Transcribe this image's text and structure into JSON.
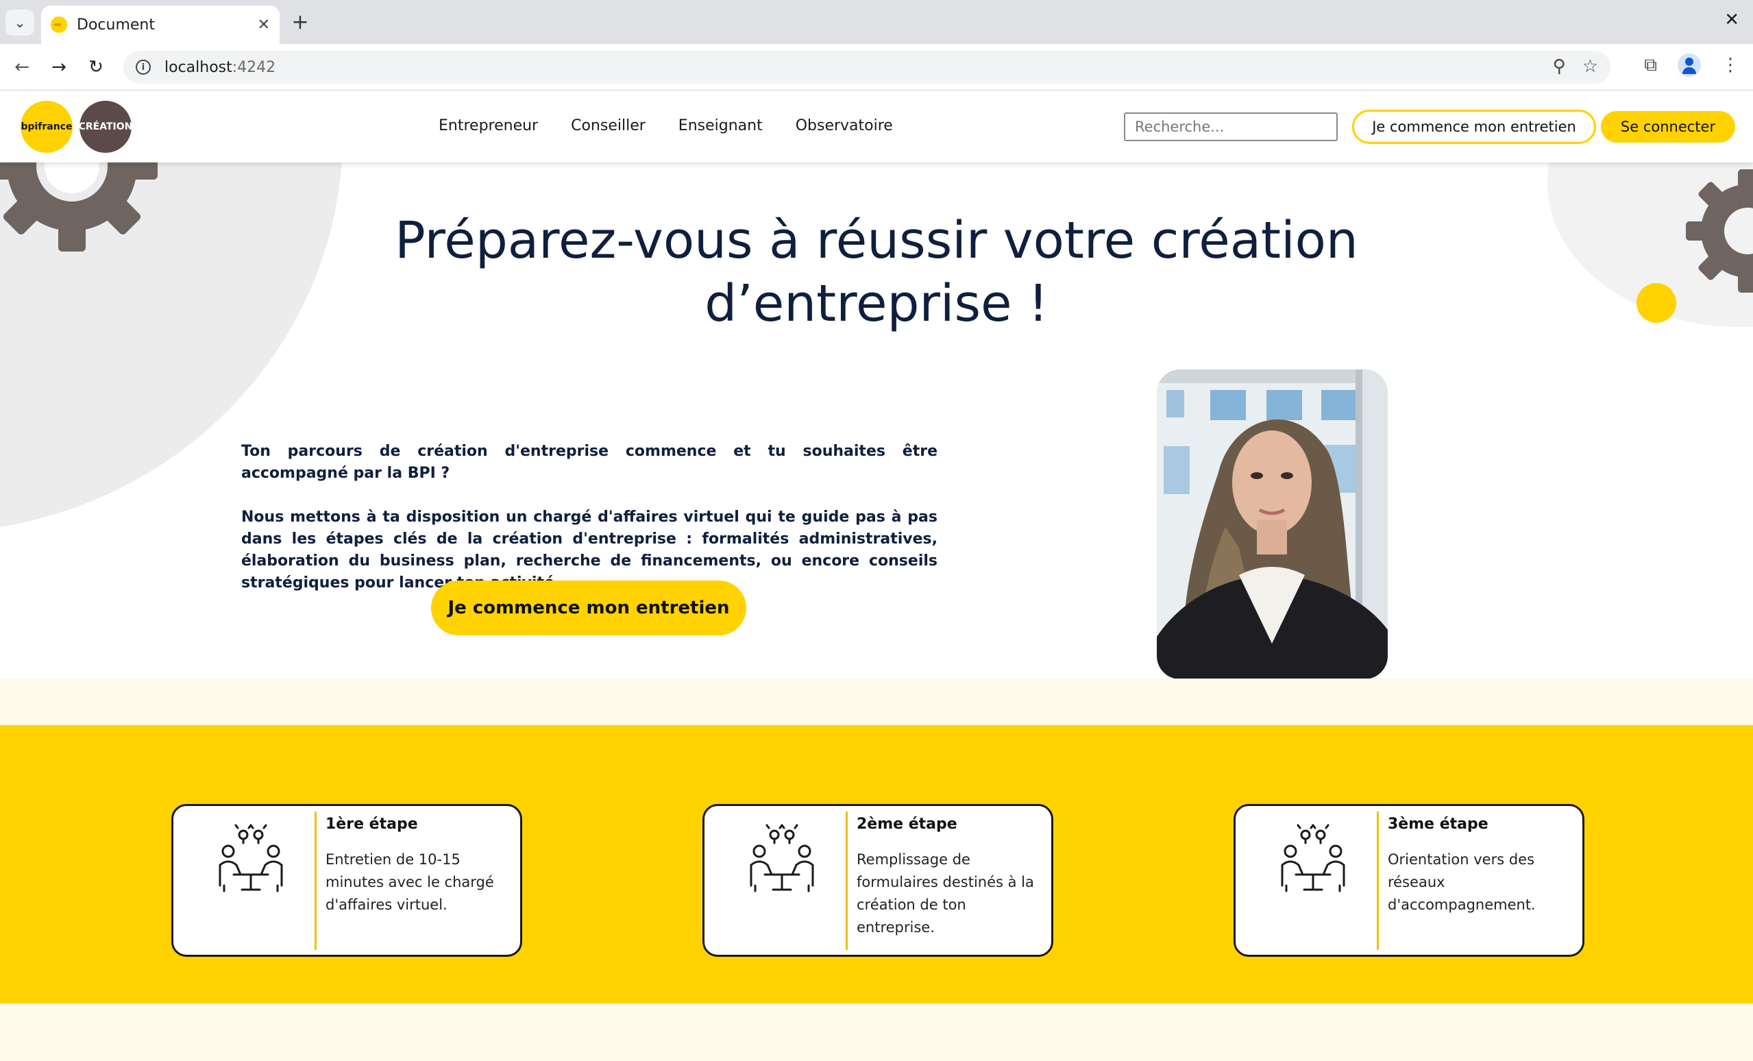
{
  "browser": {
    "tab_title": "Document",
    "url_host": "localhost",
    "url_port": ":4242"
  },
  "header": {
    "logo_bpi": "bpifrance",
    "logo_creation": "CRÉATION",
    "nav": [
      "Entrepreneur",
      "Conseiller",
      "Enseignant",
      "Observatoire"
    ],
    "search_placeholder": "Recherche...",
    "cta_outline": "Je commence mon entretien",
    "cta_login": "Se connecter"
  },
  "hero": {
    "title_line1": "Préparez-vous à réussir votre création",
    "title_line2": "d’entreprise !",
    "paragraph1": "Ton parcours de création d'entreprise commence et tu souhaites être accompagné par la BPI ?",
    "paragraph2": "Nous mettons à ta disposition un chargé d'affaires virtuel qui te guide pas à pas dans les étapes clés de la création d'entreprise : formalités administratives, élaboration du business plan, recherche de financements, ou encore conseils stratégiques pour lancer ton activité.",
    "cta": "Je commence mon entretien"
  },
  "steps": [
    {
      "title": "1ère étape",
      "desc": "Entretien de 10-15 minutes avec le chargé d'affaires virtuel."
    },
    {
      "title": "2ème étape",
      "desc": "Remplissage de formulaires destinés à la création de ton entreprise."
    },
    {
      "title": "3ème étape",
      "desc": "Orientation vers des réseaux d'accompagnement."
    }
  ],
  "colors": {
    "brand_yellow": "#ffd200",
    "navy": "#0f1f3d",
    "cream": "#fffbea",
    "gear_brown": "#6e6560"
  }
}
